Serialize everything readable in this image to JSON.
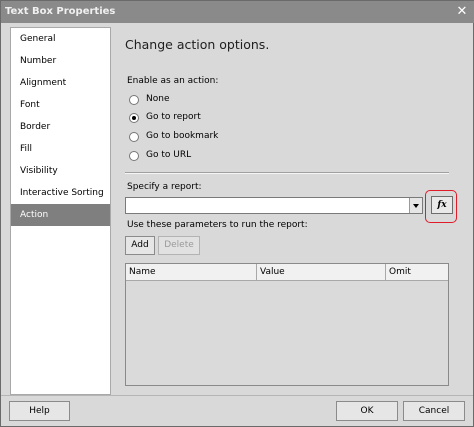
{
  "window": {
    "title": "Text Box Properties"
  },
  "sidebar": {
    "items": [
      {
        "label": "General"
      },
      {
        "label": "Number"
      },
      {
        "label": "Alignment"
      },
      {
        "label": "Font"
      },
      {
        "label": "Border"
      },
      {
        "label": "Fill"
      },
      {
        "label": "Visibility"
      },
      {
        "label": "Interactive Sorting"
      },
      {
        "label": "Action",
        "selected": true
      }
    ]
  },
  "main": {
    "heading": "Change action options.",
    "enable_label": "Enable as an action:",
    "options": [
      {
        "label": "None",
        "checked": false
      },
      {
        "label": "Go to report",
        "checked": true
      },
      {
        "label": "Go to bookmark",
        "checked": false
      },
      {
        "label": "Go to URL",
        "checked": false
      }
    ],
    "specify_label": "Specify a report:",
    "report_value": "",
    "fx_label": "fx",
    "params_label": "Use these parameters to run the report:",
    "add_label": "Add",
    "delete_label": "Delete",
    "table": {
      "columns": [
        "Name",
        "Value",
        "Omit"
      ],
      "rows": []
    }
  },
  "footer": {
    "help": "Help",
    "ok": "OK",
    "cancel": "Cancel"
  },
  "colors": {
    "selected_bg": "#7f7f7f",
    "highlight": "#e01b2a",
    "title_bg": "#8a8a8a"
  }
}
